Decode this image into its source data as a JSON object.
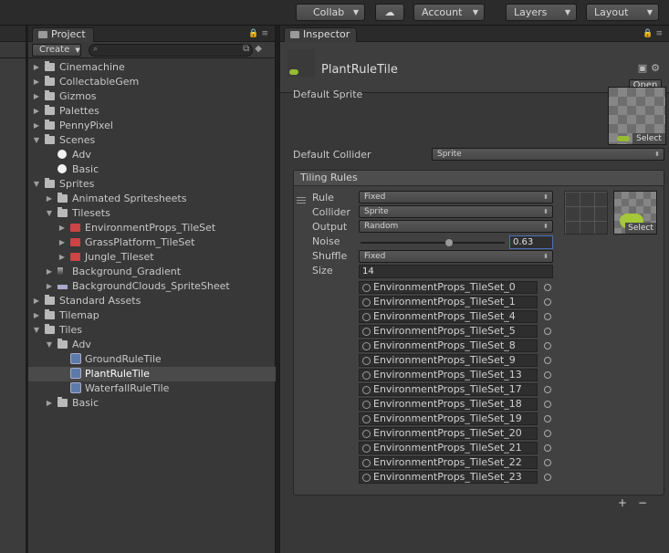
{
  "toolbar": {
    "collab_label": "Collab",
    "account_label": "Account",
    "layers_label": "Layers",
    "layout_label": "Layout"
  },
  "project": {
    "tab_label": "Project",
    "create_label": "Create",
    "tree": [
      {
        "label": "Cinemachine",
        "icon": "folder-icon",
        "expander": "closed"
      },
      {
        "label": "CollectableGem",
        "icon": "folder-icon",
        "expander": "closed"
      },
      {
        "label": "Gizmos",
        "icon": "folder-icon",
        "expander": "closed"
      },
      {
        "label": "Palettes",
        "icon": "folder-icon",
        "expander": "closed"
      },
      {
        "label": "PennyPixel",
        "icon": "folder-icon",
        "expander": "closed"
      },
      {
        "label": "Scenes",
        "icon": "folder-icon",
        "expander": "open"
      },
      {
        "label": "Adv",
        "icon": "unity-scene-icon",
        "expander": "none"
      },
      {
        "label": "Basic",
        "icon": "unity-scene-icon",
        "expander": "none"
      },
      {
        "label": "Sprites",
        "icon": "folder-icon",
        "expander": "open"
      },
      {
        "label": "Animated Spritesheets",
        "icon": "folder-icon",
        "expander": "closed"
      },
      {
        "label": "Tilesets",
        "icon": "folder-icon",
        "expander": "open"
      },
      {
        "label": "EnvironmentProps_TileSet",
        "icon": "tileset-icon",
        "expander": "closed"
      },
      {
        "label": "GrassPlatform_TileSet",
        "icon": "tileset-icon",
        "expander": "closed"
      },
      {
        "label": "Jungle_Tileset",
        "icon": "tileset-icon",
        "expander": "closed"
      },
      {
        "label": "Background_Gradient",
        "icon": "gradient-icon",
        "expander": "closed"
      },
      {
        "label": "BackgroundClouds_SpriteSheet",
        "icon": "clouds-icon",
        "expander": "closed"
      },
      {
        "label": "Standard Assets",
        "icon": "folder-icon",
        "expander": "closed"
      },
      {
        "label": "Tilemap",
        "icon": "folder-icon",
        "expander": "closed"
      },
      {
        "label": "Tiles",
        "icon": "folder-icon",
        "expander": "open"
      },
      {
        "label": "Adv",
        "icon": "folder-icon",
        "expander": "open"
      },
      {
        "label": "GroundRuleTile",
        "icon": "rule-tile-icon",
        "expander": "none"
      },
      {
        "label": "PlantRuleTile",
        "icon": "rule-tile-icon",
        "expander": "none",
        "selected": true
      },
      {
        "label": "WaterfallRuleTile",
        "icon": "rule-tile-icon",
        "expander": "none"
      },
      {
        "label": "Basic",
        "icon": "folder-icon",
        "expander": "closed"
      }
    ]
  },
  "inspector": {
    "tab_label": "Inspector",
    "asset_name": "PlantRuleTile",
    "open_label": "Open",
    "default_sprite_label": "Default Sprite",
    "select_label": "Select",
    "default_collider_label": "Default Collider",
    "default_collider_value": "Sprite",
    "tiling_rules_title": "Tiling Rules",
    "rule": {
      "rule_label": "Rule",
      "rule_value": "Fixed",
      "collider_label": "Collider",
      "collider_value": "Sprite",
      "output_label": "Output",
      "output_value": "Random",
      "noise_label": "Noise",
      "noise_value": "0.63",
      "shuffle_label": "Shuffle",
      "shuffle_value": "Fixed",
      "size_label": "Size",
      "size_value": "14",
      "select_label": "Select",
      "sprites": [
        "EnvironmentProps_TileSet_0",
        "EnvironmentProps_TileSet_1",
        "EnvironmentProps_TileSet_4",
        "EnvironmentProps_TileSet_5",
        "EnvironmentProps_TileSet_8",
        "EnvironmentProps_TileSet_9",
        "EnvironmentProps_TileSet_13",
        "EnvironmentProps_TileSet_17",
        "EnvironmentProps_TileSet_18",
        "EnvironmentProps_TileSet_19",
        "EnvironmentProps_TileSet_20",
        "EnvironmentProps_TileSet_21",
        "EnvironmentProps_TileSet_22",
        "EnvironmentProps_TileSet_23"
      ]
    },
    "add_label": "+",
    "remove_label": "−"
  }
}
